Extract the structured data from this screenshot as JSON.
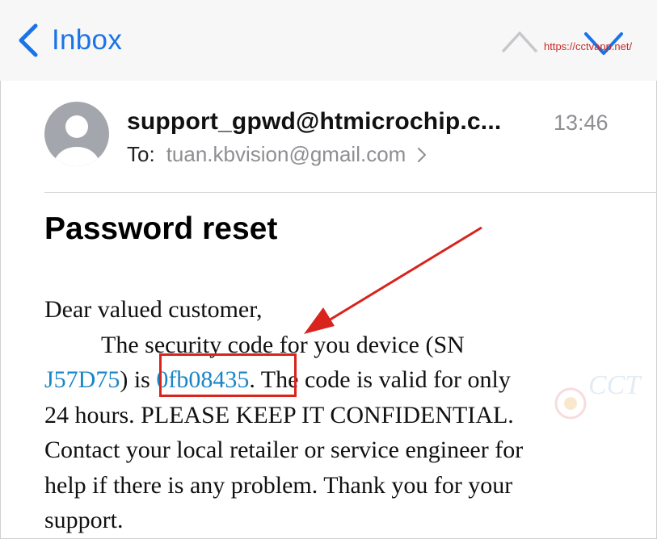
{
  "navbar": {
    "back_label": "Inbox",
    "watermark_url": "https://cctvapp.net/"
  },
  "message": {
    "sender": "support_gpwd@htmicrochip.c...",
    "time": "13:46",
    "to_label": "To:",
    "to_address": "tuan.kbvision@gmail.com",
    "subject": "Password reset"
  },
  "body": {
    "greeting": "Dear valued customer,",
    "line2": "The security code for you device (SN",
    "serial": "J57D75",
    "is_text": ") is ",
    "code": "0fb08435",
    "after_code": ". The code is valid for only",
    "line4": "24 hours. PLEASE KEEP IT CONFIDENTIAL.",
    "line5": "Contact your local retailer or service engineer for",
    "line6": "help if there is any problem. Thank you for your",
    "line7": "support."
  },
  "icons": {
    "back": "chevron-left-icon",
    "prev": "chevron-up-icon",
    "next": "chevron-down-icon",
    "avatar": "person-avatar-icon",
    "to_chevron": "chevron-right-icon"
  },
  "colors": {
    "accent": "#1a74e8",
    "link": "#1a86c7",
    "annotation": "#d9231d",
    "secondary_text": "#8e8e93"
  }
}
